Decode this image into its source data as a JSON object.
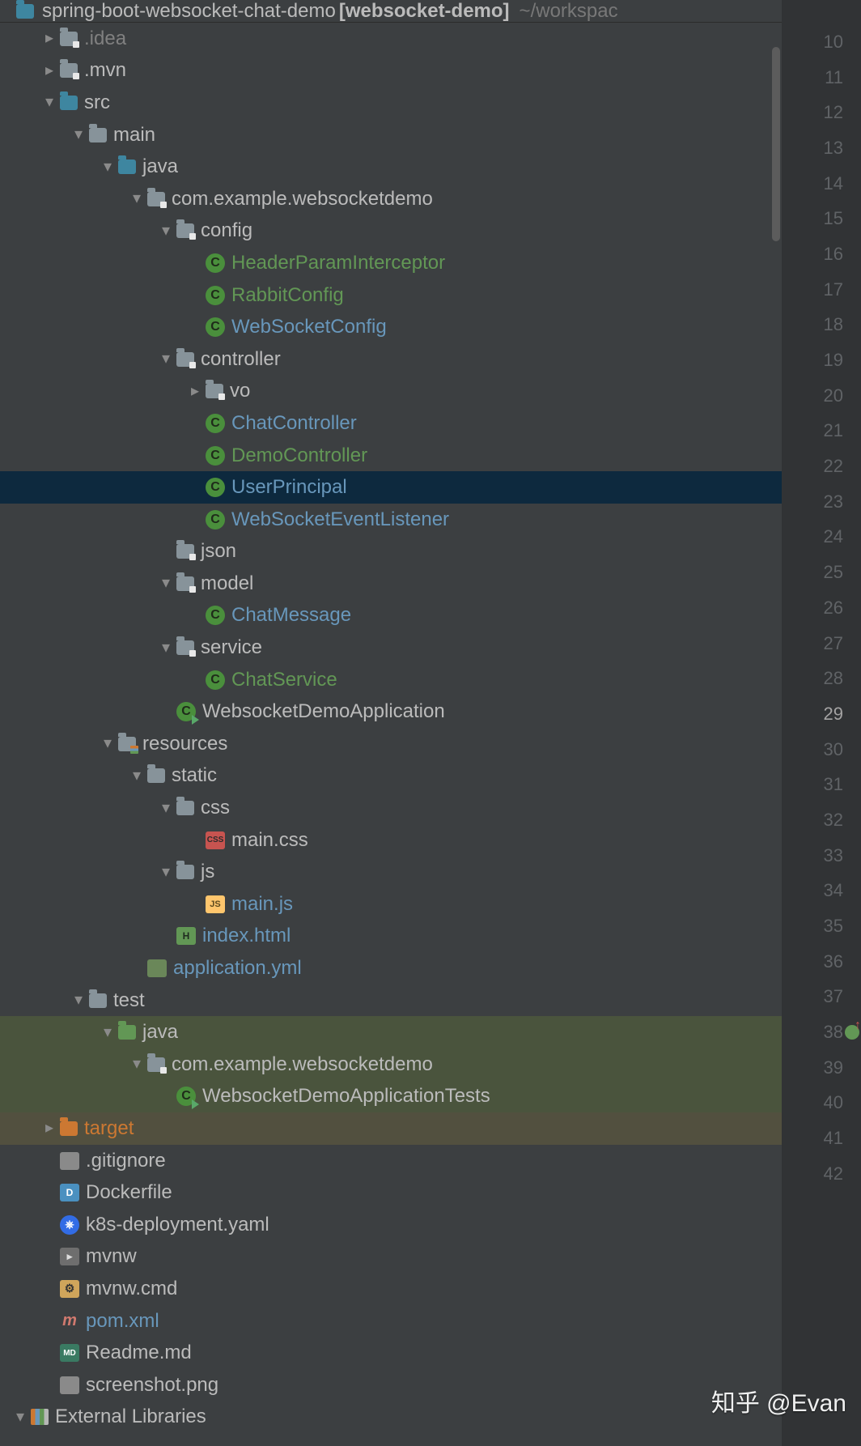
{
  "breadcrumb": {
    "project": "spring-boot-websocket-chat-demo",
    "module_tag": "[websocket-demo]",
    "path_hint": "~/workspac"
  },
  "tree": [
    {
      "depth": 0,
      "arrow": "expanded",
      "icon": "folder",
      "label": "spring-boot-websocket-chat-demo",
      "class": "",
      "hidden": true
    },
    {
      "depth": 1,
      "arrow": "collapsed",
      "icon": "folder dot",
      "label": ".idea",
      "class": "dim"
    },
    {
      "depth": 1,
      "arrow": "collapsed",
      "icon": "folder dot",
      "label": ".mvn",
      "class": ""
    },
    {
      "depth": 1,
      "arrow": "expanded",
      "icon": "folder src",
      "label": "src",
      "class": ""
    },
    {
      "depth": 2,
      "arrow": "expanded",
      "icon": "folder",
      "label": "main",
      "class": ""
    },
    {
      "depth": 3,
      "arrow": "expanded",
      "icon": "folder src",
      "label": "java",
      "class": ""
    },
    {
      "depth": 4,
      "arrow": "expanded",
      "icon": "folder dot",
      "label": "com.example.websocketdemo",
      "class": ""
    },
    {
      "depth": 5,
      "arrow": "expanded",
      "icon": "folder dot",
      "label": "config",
      "class": ""
    },
    {
      "depth": 6,
      "arrow": "none",
      "icon": "class",
      "label": "HeaderParamInterceptor",
      "class": "green"
    },
    {
      "depth": 6,
      "arrow": "none",
      "icon": "class",
      "label": "RabbitConfig",
      "class": "green"
    },
    {
      "depth": 6,
      "arrow": "none",
      "icon": "class",
      "label": "WebSocketConfig",
      "class": "blue"
    },
    {
      "depth": 5,
      "arrow": "expanded",
      "icon": "folder dot",
      "label": "controller",
      "class": ""
    },
    {
      "depth": 6,
      "arrow": "collapsed",
      "icon": "folder dot",
      "label": "vo",
      "class": ""
    },
    {
      "depth": 6,
      "arrow": "none",
      "icon": "class",
      "label": "ChatController",
      "class": "blue"
    },
    {
      "depth": 6,
      "arrow": "none",
      "icon": "class",
      "label": "DemoController",
      "class": "green"
    },
    {
      "depth": 6,
      "arrow": "none",
      "icon": "class",
      "label": "UserPrincipal",
      "class": "blue",
      "row": "selected"
    },
    {
      "depth": 6,
      "arrow": "none",
      "icon": "class",
      "label": "WebSocketEventListener",
      "class": "blue"
    },
    {
      "depth": 5,
      "arrow": "none",
      "icon": "folder dot",
      "label": "json",
      "class": ""
    },
    {
      "depth": 5,
      "arrow": "expanded",
      "icon": "folder dot",
      "label": "model",
      "class": ""
    },
    {
      "depth": 6,
      "arrow": "none",
      "icon": "class",
      "label": "ChatMessage",
      "class": "blue"
    },
    {
      "depth": 5,
      "arrow": "expanded",
      "icon": "folder dot",
      "label": "service",
      "class": ""
    },
    {
      "depth": 6,
      "arrow": "none",
      "icon": "class",
      "label": "ChatService",
      "class": "green"
    },
    {
      "depth": 5,
      "arrow": "none",
      "icon": "class runnable",
      "label": "WebsocketDemoApplication",
      "class": ""
    },
    {
      "depth": 3,
      "arrow": "expanded",
      "icon": "folder resources",
      "label": "resources",
      "class": ""
    },
    {
      "depth": 4,
      "arrow": "expanded",
      "icon": "folder",
      "label": "static",
      "class": ""
    },
    {
      "depth": 5,
      "arrow": "expanded",
      "icon": "folder",
      "label": "css",
      "class": ""
    },
    {
      "depth": 6,
      "arrow": "none",
      "icon": "file-css",
      "label": "main.css",
      "class": ""
    },
    {
      "depth": 5,
      "arrow": "expanded",
      "icon": "folder",
      "label": "js",
      "class": ""
    },
    {
      "depth": 6,
      "arrow": "none",
      "icon": "file-js",
      "label": "main.js",
      "class": "blue"
    },
    {
      "depth": 5,
      "arrow": "none",
      "icon": "file-html",
      "label": "index.html",
      "class": "blue"
    },
    {
      "depth": 4,
      "arrow": "none",
      "icon": "file-yml",
      "label": "application.yml",
      "class": "blue"
    },
    {
      "depth": 2,
      "arrow": "expanded",
      "icon": "folder",
      "label": "test",
      "class": ""
    },
    {
      "depth": 3,
      "arrow": "expanded",
      "icon": "folder test",
      "label": "java",
      "class": "",
      "row": "vcs-green-bg"
    },
    {
      "depth": 4,
      "arrow": "expanded",
      "icon": "folder dot",
      "label": "com.example.websocketdemo",
      "class": "",
      "row": "vcs-green-bg"
    },
    {
      "depth": 5,
      "arrow": "none",
      "icon": "class runnable",
      "label": "WebsocketDemoApplicationTests",
      "class": "",
      "row": "vcs-green-bg"
    },
    {
      "depth": 1,
      "arrow": "collapsed",
      "icon": "folder excluded",
      "label": "target",
      "class": "orange",
      "row": "vcs-orange-bg"
    },
    {
      "depth": 1,
      "arrow": "none",
      "icon": "file-gitignore",
      "label": ".gitignore",
      "class": ""
    },
    {
      "depth": 1,
      "arrow": "none",
      "icon": "file-docker",
      "label": "Dockerfile",
      "class": ""
    },
    {
      "depth": 1,
      "arrow": "none",
      "icon": "file-k8s",
      "label": "k8s-deployment.yaml",
      "class": ""
    },
    {
      "depth": 1,
      "arrow": "none",
      "icon": "file-sh",
      "label": "mvnw",
      "class": ""
    },
    {
      "depth": 1,
      "arrow": "none",
      "icon": "file-cmd",
      "label": "mvnw.cmd",
      "class": ""
    },
    {
      "depth": 1,
      "arrow": "none",
      "icon": "file-pom",
      "label": "pom.xml",
      "class": "blue"
    },
    {
      "depth": 1,
      "arrow": "none",
      "icon": "file-md",
      "label": "Readme.md",
      "class": ""
    },
    {
      "depth": 1,
      "arrow": "none",
      "icon": "file-img",
      "label": "screenshot.png",
      "class": ""
    },
    {
      "depth": 0,
      "arrow": "expanded",
      "icon": "libs",
      "label": "External Libraries",
      "class": ""
    }
  ],
  "gutter": {
    "start": 10,
    "end": 42,
    "current": 29,
    "marker_at": 38
  },
  "watermark": "知乎 @Evan"
}
